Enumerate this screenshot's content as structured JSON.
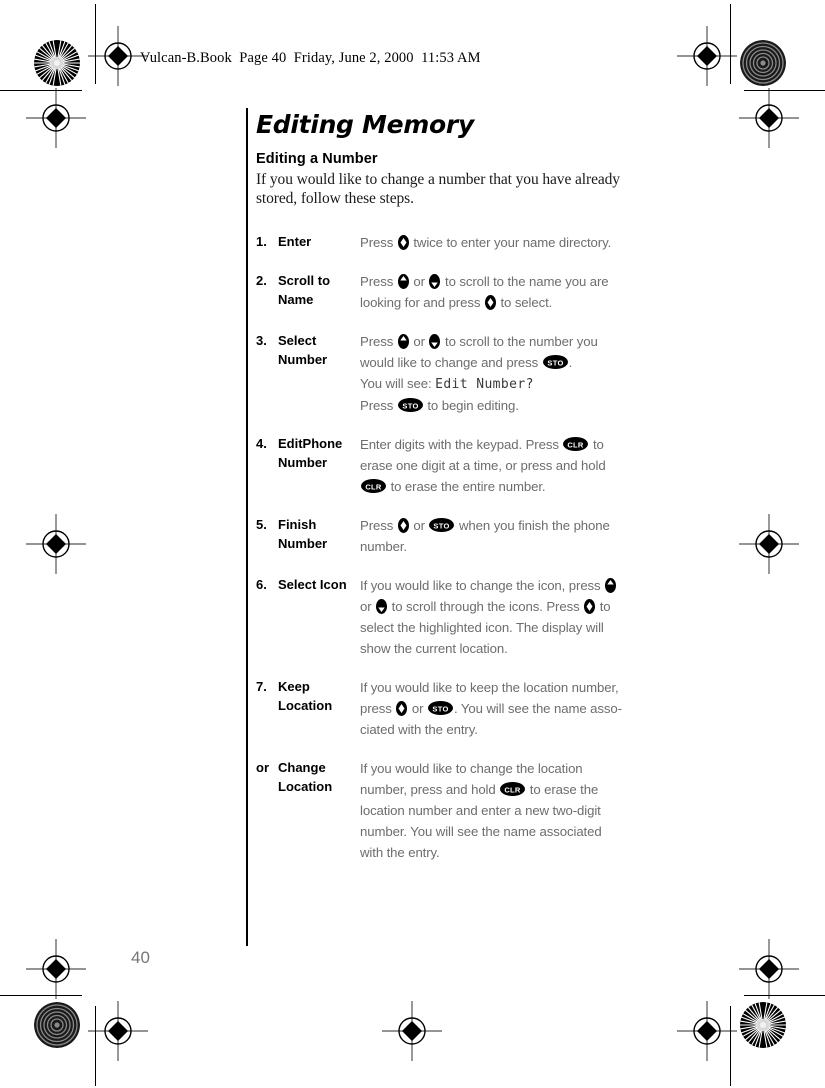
{
  "document": {
    "file_info": "Vulcan-B.Book  Page 40  Friday, June 2, 2000  11:53 AM",
    "chapter_title": "Editing Memory",
    "section_title": "Editing a Number",
    "intro": "If you would like to change a number that you have already stored, follow these steps.",
    "page_number": "40"
  },
  "keys": {
    "nav_select": "nav-select-key",
    "nav_up": "nav-up-key",
    "nav_down": "nav-down-key",
    "sto": "STO",
    "clr": "CLR"
  },
  "steps": [
    {
      "num": "1.",
      "label": "Enter",
      "lines": [
        [
          {
            "t": "text",
            "v": "Press "
          },
          {
            "t": "key",
            "v": "nav_select"
          },
          {
            "t": "text",
            "v": " twice to enter your name directory."
          }
        ]
      ]
    },
    {
      "num": "2.",
      "label": "Scroll to Name",
      "lines": [
        [
          {
            "t": "text",
            "v": "Press "
          },
          {
            "t": "key",
            "v": "nav_up"
          },
          {
            "t": "text",
            "v": " or "
          },
          {
            "t": "key",
            "v": "nav_down"
          },
          {
            "t": "text",
            "v": " to scroll to the name you are"
          }
        ],
        [
          {
            "t": "text",
            "v": "looking for and press "
          },
          {
            "t": "key",
            "v": "nav_select"
          },
          {
            "t": "text",
            "v": " to select."
          }
        ]
      ]
    },
    {
      "num": "3.",
      "label": "Select Number",
      "lines": [
        [
          {
            "t": "text",
            "v": "Press "
          },
          {
            "t": "key",
            "v": "nav_up"
          },
          {
            "t": "text",
            "v": " or "
          },
          {
            "t": "key",
            "v": "nav_down"
          },
          {
            "t": "text",
            "v": " to scroll to the number you"
          }
        ],
        [
          {
            "t": "text",
            "v": "would like to change and press "
          },
          {
            "t": "pill",
            "v": "sto"
          },
          {
            "t": "text",
            "v": "."
          }
        ],
        [
          {
            "t": "text",
            "v": "You will see: "
          },
          {
            "t": "lcd",
            "v": "Edit Number?"
          }
        ],
        [
          {
            "t": "text",
            "v": "Press "
          },
          {
            "t": "pill",
            "v": "sto"
          },
          {
            "t": "text",
            "v": " to begin editing."
          }
        ]
      ]
    },
    {
      "num": "4.",
      "label": "EditPhone Number",
      "lines": [
        [
          {
            "t": "text",
            "v": "Enter digits with the keypad. Press "
          },
          {
            "t": "pill",
            "v": "clr"
          },
          {
            "t": "text",
            "v": " to"
          }
        ],
        [
          {
            "t": "text",
            "v": "erase one digit at a time, or press and hold"
          }
        ],
        [
          {
            "t": "pill",
            "v": "clr"
          },
          {
            "t": "text",
            "v": " to erase the entire number."
          }
        ]
      ]
    },
    {
      "num": "5.",
      "label": "Finish Number",
      "lines": [
        [
          {
            "t": "text",
            "v": "Press "
          },
          {
            "t": "key",
            "v": "nav_select"
          },
          {
            "t": "text",
            "v": " or "
          },
          {
            "t": "pill",
            "v": "sto"
          },
          {
            "t": "text",
            "v": " when you finish the phone"
          }
        ],
        [
          {
            "t": "text",
            "v": "number."
          }
        ]
      ]
    },
    {
      "num": "6.",
      "label": "Select Icon",
      "lines": [
        [
          {
            "t": "text",
            "v": "If you would like to change the icon, press "
          },
          {
            "t": "key",
            "v": "nav_up"
          }
        ],
        [
          {
            "t": "text",
            "v": "or "
          },
          {
            "t": "key",
            "v": "nav_down"
          },
          {
            "t": "text",
            "v": " to scroll through the icons. Press "
          },
          {
            "t": "key",
            "v": "nav_select"
          },
          {
            "t": "text",
            "v": " to"
          }
        ],
        [
          {
            "t": "text",
            "v": "select the highlighted icon. The display will"
          }
        ],
        [
          {
            "t": "text",
            "v": "show the current location."
          }
        ]
      ]
    },
    {
      "num": "7.",
      "label": "Keep Location",
      "lines": [
        [
          {
            "t": "text",
            "v": "If you would like to keep the location number,"
          }
        ],
        [
          {
            "t": "text",
            "v": "press "
          },
          {
            "t": "key",
            "v": "nav_select"
          },
          {
            "t": "text",
            "v": " or "
          },
          {
            "t": "pill",
            "v": "sto"
          },
          {
            "t": "text",
            "v": ". You will see the name asso-"
          }
        ],
        [
          {
            "t": "text",
            "v": "ciated with the entry."
          }
        ]
      ]
    },
    {
      "num": "or",
      "label": "Change Location",
      "lines": [
        [
          {
            "t": "text",
            "v": "If you would like to change the location"
          }
        ],
        [
          {
            "t": "text",
            "v": "number, press and hold "
          },
          {
            "t": "pill",
            "v": "clr"
          },
          {
            "t": "text",
            "v": " to erase the"
          }
        ],
        [
          {
            "t": "text",
            "v": "location number and enter a new two-digit"
          }
        ],
        [
          {
            "t": "text",
            "v": "number. You will see the name associated"
          }
        ],
        [
          {
            "t": "text",
            "v": "with the entry."
          }
        ]
      ]
    }
  ]
}
